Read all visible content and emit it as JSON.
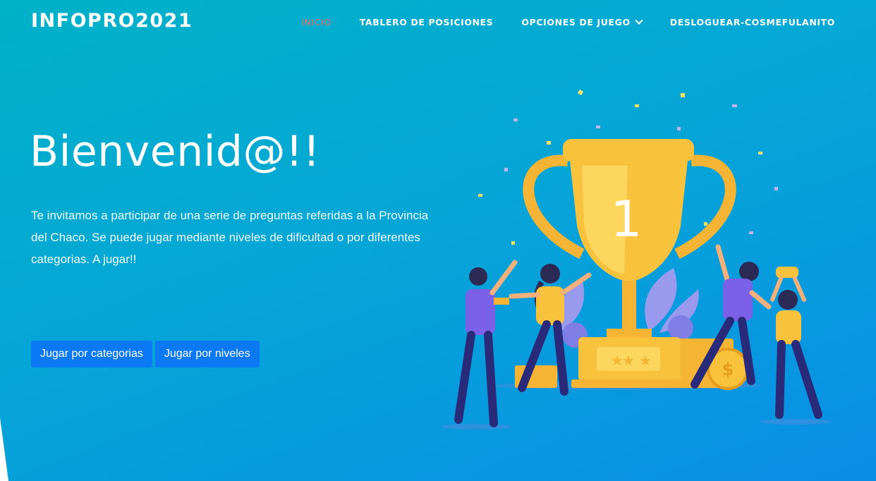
{
  "header": {
    "brand": "INFOPRO2021",
    "nav": [
      {
        "label": "INICIO",
        "active": true
      },
      {
        "label": "TABLERO DE POSICIONES",
        "active": false
      },
      {
        "label": "OPCIONES DE JUEGO",
        "active": false,
        "dropdown": true
      },
      {
        "label": "DESLOGUEAR-COSMEFULANITO",
        "active": false
      }
    ]
  },
  "hero": {
    "title": "Bienvenid@!!",
    "text": "Te invitamos a participar de una serie de preguntas referidas a la Provincia del Chaco. Se puede jugar mediante niveles de dificultad o por diferentes categorias. A jugar!!",
    "buttons": {
      "categories": "Jugar por categorias",
      "levels": "Jugar por niveles"
    }
  },
  "illustration": {
    "trophy_number": "1",
    "icon": "trophy-celebration-illustration"
  },
  "colors": {
    "gradient_start": "#00b2c8",
    "gradient_end": "#0a8ee6",
    "active_nav": "#f26b6b",
    "button": "#0b79f4",
    "trophy": "#f8c23c"
  }
}
